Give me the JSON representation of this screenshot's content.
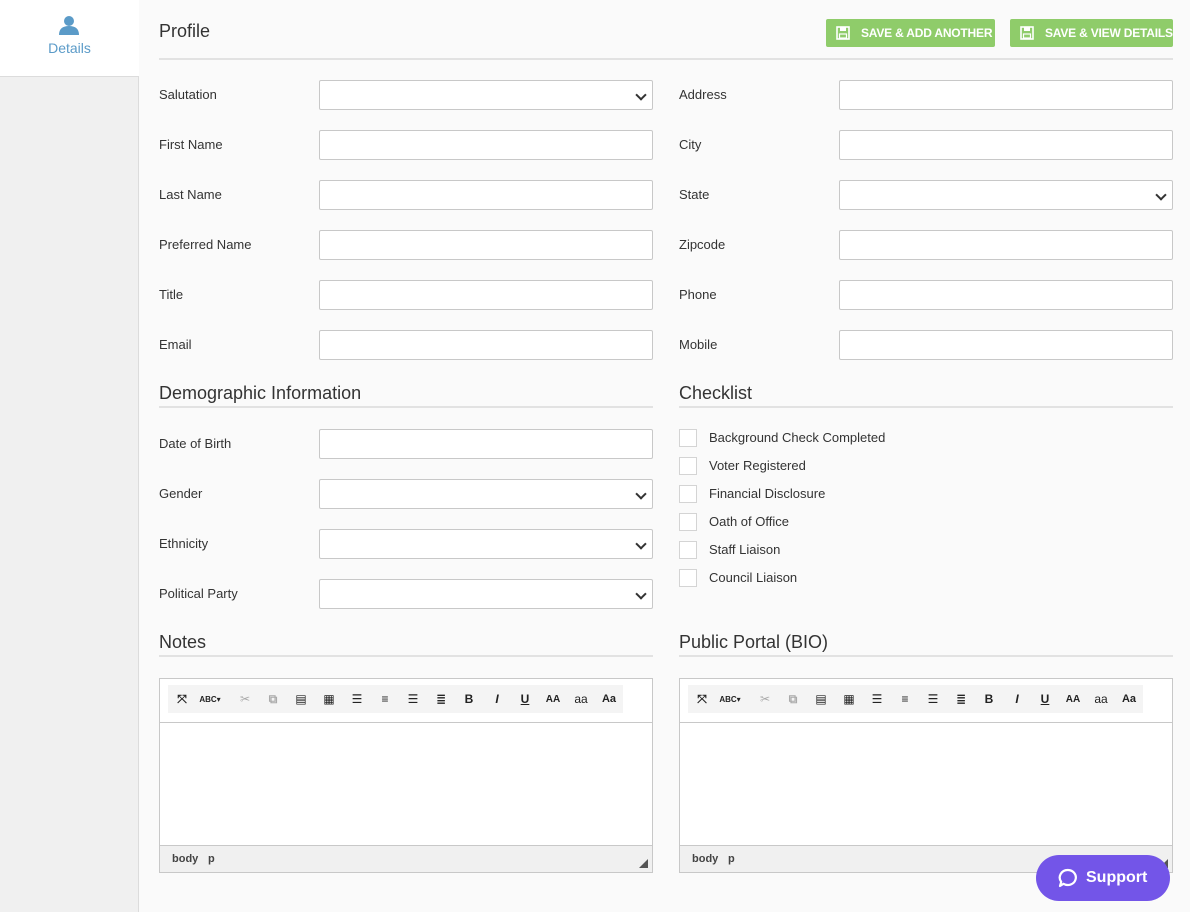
{
  "sidebar": {
    "tab_label": "Details",
    "tab_icon": "user-icon"
  },
  "header": {
    "title": "Profile",
    "save_add_label": "SAVE & ADD ANOTHER",
    "save_view_label": "SAVE & VIEW DETAILS"
  },
  "profile": {
    "salutation": "Salutation",
    "first_name": "First Name",
    "last_name": "Last Name",
    "preferred_name": "Preferred Name",
    "title": "Title",
    "email": "Email",
    "address": "Address",
    "city": "City",
    "state": "State",
    "zipcode": "Zipcode",
    "phone": "Phone",
    "mobile": "Mobile"
  },
  "demographic": {
    "title": "Demographic Information",
    "dob": "Date of Birth",
    "gender": "Gender",
    "ethnicity": "Ethnicity",
    "party": "Political Party"
  },
  "checklist": {
    "title": "Checklist",
    "items": [
      "Background Check Completed",
      "Voter Registered",
      "Financial Disclosure",
      "Oath of Office",
      "Staff Liaison",
      "Council Liaison"
    ]
  },
  "notes": {
    "title": "Notes",
    "status_body": "body",
    "status_p": "p"
  },
  "bio": {
    "title": "Public Portal (BIO)",
    "status_body": "body",
    "status_p": "p"
  },
  "toolbar": {
    "uppercase": "AA",
    "lowercase": "aa",
    "titlecase": "Aa",
    "bold": "B",
    "italic": "I",
    "underline": "U"
  },
  "support": {
    "label": "Support"
  },
  "colors": {
    "accent_green": "#8fcc6a",
    "link_blue": "#5b9bc8",
    "support_purple": "#7355e8"
  }
}
